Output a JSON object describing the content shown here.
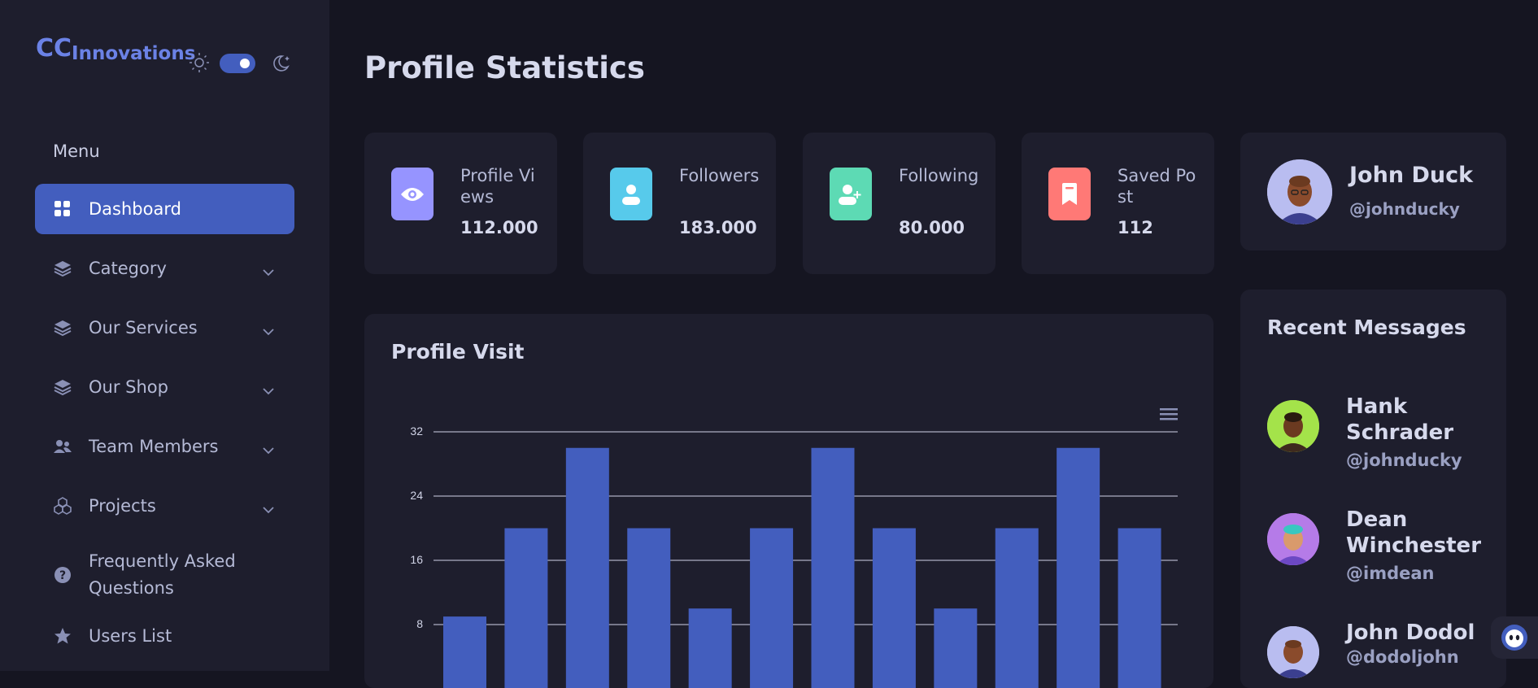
{
  "app": {
    "logo_cc": "CC",
    "logo_rest": "Innovations"
  },
  "theme": {
    "dark_mode": true
  },
  "sidebar": {
    "menu_title": "Menu",
    "items": [
      {
        "label": "Dashboard",
        "icon": "grid-icon",
        "active": true
      },
      {
        "label": "Category",
        "icon": "stack-icon",
        "has_submenu": true
      },
      {
        "label": "Our Services",
        "icon": "stack-icon",
        "has_submenu": true
      },
      {
        "label": "Our Shop",
        "icon": "stack-icon",
        "has_submenu": true
      },
      {
        "label": "Team Members",
        "icon": "people-icon",
        "has_submenu": true
      },
      {
        "label": "Projects",
        "icon": "boxes-icon",
        "has_submenu": true
      },
      {
        "label": "Frequently Asked Questions",
        "icon": "question-icon"
      },
      {
        "label": "Users List",
        "icon": "star-icon"
      }
    ]
  },
  "page": {
    "title": "Profile Statistics"
  },
  "stats": [
    {
      "label": "Profile Views",
      "value": "112.000",
      "color": "#9694ff",
      "icon": "eye-icon"
    },
    {
      "label": "Followers",
      "value": "183.000",
      "color": "#57caeb",
      "icon": "person-icon"
    },
    {
      "label": "Following",
      "value": "80.000",
      "color": "#5ddab4",
      "icon": "person-add-icon"
    },
    {
      "label": "Saved Post",
      "value": "112",
      "color": "#ff7976",
      "icon": "bookmark-icon"
    }
  ],
  "profile": {
    "name": "John Duck",
    "handle": "@johnducky"
  },
  "chart": {
    "title": "Profile Visit"
  },
  "chart_data": {
    "type": "bar",
    "title": "Profile Visit",
    "values": [
      9,
      20,
      30,
      20,
      10,
      20,
      30,
      20,
      10,
      20,
      30,
      20
    ],
    "ylim": [
      0,
      32
    ],
    "yticks": [
      8,
      16,
      24,
      32
    ],
    "grid": true,
    "color": "#435ebe"
  },
  "messages": {
    "title": "Recent Messages",
    "items": [
      {
        "name": "Hank Schrader",
        "handle": "@johnducky",
        "avatar_color": "#a4e34a"
      },
      {
        "name": "Dean Winchester",
        "handle": "@imdean",
        "avatar_color": "#b57be8"
      },
      {
        "name": "John Dodol",
        "handle": "@dodoljohn",
        "avatar_color": "#b9bdf0"
      }
    ]
  },
  "colors": {
    "accent": "#435ebe",
    "sidebar_bg": "#1e1e2d",
    "page_bg": "#151521"
  }
}
